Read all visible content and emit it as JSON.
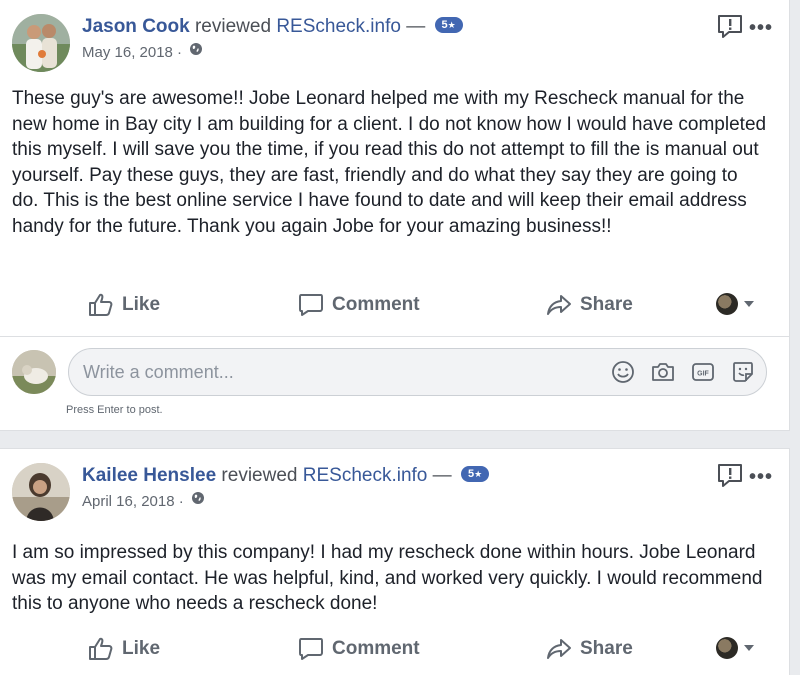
{
  "posts": [
    {
      "author": "Jason Cook",
      "verb": "reviewed",
      "page": "REScheck.info",
      "dash": "—",
      "rating": "5",
      "date": "May 16, 2018 ·",
      "body": "These guy's are awesome!! Jobe Leonard helped me with my Rescheck manual for the new home in Bay city I am building for a client. I do not know how I would have completed this myself. I will save you the time, if you read this do not attempt to fill the is manual out yourself. Pay these guys, they are fast, friendly and do what they say they are going to do. This is the best online service I have found to date and will keep their email address handy for the future. Thank you again Jobe for your amazing business!!",
      "actions": {
        "like": "Like",
        "comment": "Comment",
        "share": "Share"
      }
    },
    {
      "author": "Kailee Henslee",
      "verb": "reviewed",
      "page": "REScheck.info",
      "dash": "—",
      "rating": "5",
      "date": "April 16, 2018 ·",
      "body": "I am so impressed by this company! I had my rescheck done within hours. Jobe Leonard was my email contact. He was helpful, kind, and worked very quickly. I would recommend this to anyone who needs a rescheck done!",
      "actions": {
        "like": "Like",
        "comment": "Comment",
        "share": "Share"
      }
    }
  ],
  "comment_box": {
    "placeholder": "Write a comment...",
    "hint": "Press Enter to post."
  },
  "icons": {
    "privacy": "globe-icon",
    "report": "report-icon",
    "more": "more-icon",
    "like": "thumbs-up-icon",
    "comment": "comment-bubble-icon",
    "share": "share-arrow-icon",
    "emoji": "emoji-icon",
    "camera": "camera-icon",
    "gif": "gif-icon",
    "sticker": "sticker-icon",
    "more_glyph": "•••",
    "star_glyph": "★",
    "gif_label": "GIF"
  },
  "colors": {
    "link": "#385898",
    "badge": "#4267b2",
    "muted": "#606770",
    "page_bg": "#e9ebee"
  }
}
